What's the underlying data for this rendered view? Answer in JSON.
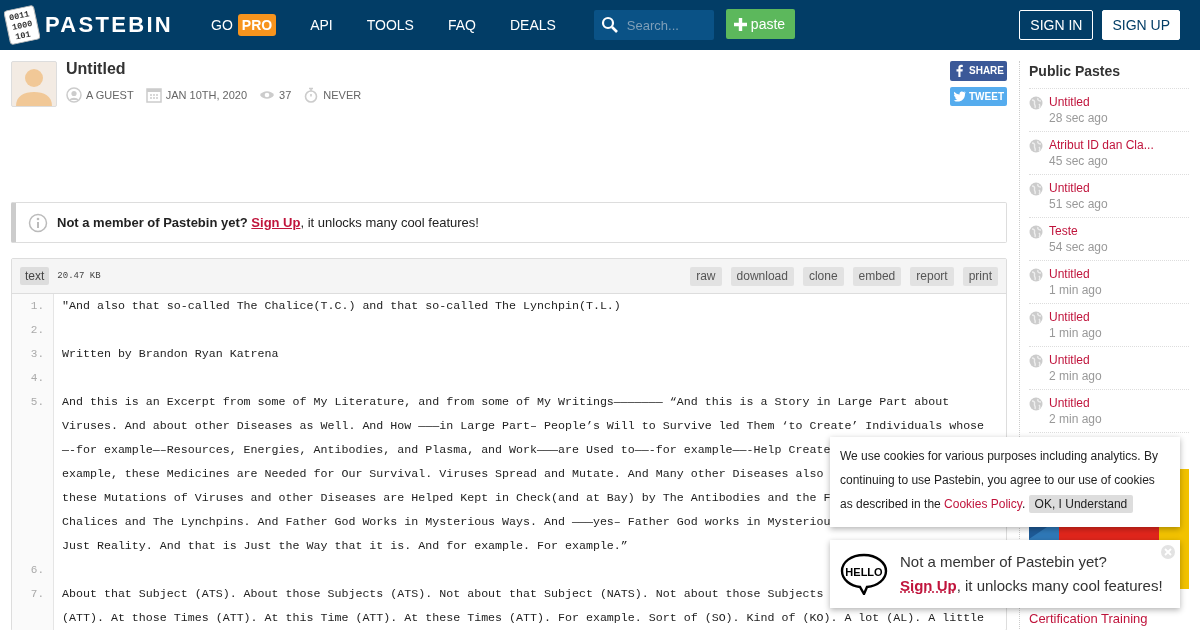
{
  "header": {
    "logo_digits": [
      "0011",
      "1000",
      "101"
    ],
    "logo_text": "PASTEBIN",
    "nav": [
      {
        "label": "GO",
        "badge": "PRO"
      },
      {
        "label": "API"
      },
      {
        "label": "TOOLS"
      },
      {
        "label": "FAQ"
      },
      {
        "label": "DEALS"
      }
    ],
    "search": {
      "placeholder": "Search..."
    },
    "new_paste": "paste",
    "sign_in": "SIGN IN",
    "sign_up": "SIGN UP"
  },
  "paste": {
    "title": "Untitled",
    "author": "A GUEST",
    "date": "JAN 10TH, 2020",
    "views": "37",
    "expires": "NEVER",
    "share": "SHARE",
    "tweet": "TWEET"
  },
  "notice": {
    "before": "**Not a member of Pastebin yet?** ",
    "link": "Sign Up",
    "after": ", it unlocks many cool features!"
  },
  "code": {
    "syntax": "text",
    "size": "20.47 KB",
    "actions": [
      "raw",
      "download",
      "clone",
      "embed",
      "report",
      "print"
    ],
    "lines": [
      {
        "number": "1.",
        "rows": [
          "\"And also that so-called The Chalice(T.C.) and that so-called The Lynchpin(T.L.)"
        ]
      },
      {
        "number": "2."
      },
      {
        "number": "3.",
        "rows": [
          "Written by Brandon Ryan Katrena"
        ]
      },
      {
        "number": "4."
      },
      {
        "number": "5.",
        "rows": [
          "And this is an Excerpt from some of My Literature, and from some of My Writings——————— “And this is a Story in Large Part about",
          "Viruses. And about other Diseases as Well. And How ———in Large Part– People’s Will to Survive led Them ‘to Create’ Individuals whose",
          "—-for example—–Resources, Energies, Antibodies, and Plasma, and Work———are Used to——-for example——-Help Create",
          "example, these Medicines are Needed for Our Survival. Viruses Spread and Mutate. And Many other Diseases also",
          "these Mutations of Viruses and other Diseases are Helped Kept in Check(and at Bay) by The Antibodies and the F",
          "Chalices and The Lynchpins. And Father God Works in Mysterious Ways. And ———yes– Father God works in Mysteriou",
          "Just Reality. And that is Just the Way that it is. And for example. For example.”"
        ]
      },
      {
        "number": "6."
      },
      {
        "number": "7.",
        "rows": [
          "About that Subject (ATS). About those Subjects (ATS). Not about that Subject (NATS). Not about those Subjects",
          "(ATT). At those Times (ATT). At this Time (ATT). At these Times (ATT). For example. Sort of (SO). Kind of (KO). A lot (AL). A little"
        ]
      }
    ]
  },
  "sidebar": {
    "title": "Public Pastes",
    "pastes": [
      {
        "title": "Untitled",
        "time": "28 sec ago"
      },
      {
        "title": "Atribut ID dan Cla...",
        "time": "45 sec ago"
      },
      {
        "title": "Untitled",
        "time": "51 sec ago"
      },
      {
        "title": "Teste",
        "time": "54 sec ago"
      },
      {
        "title": "Untitled",
        "time": "1 min ago"
      },
      {
        "title": "Untitled",
        "time": "1 min ago"
      },
      {
        "title": "Untitled",
        "time": "2 min ago"
      },
      {
        "title": "Untitled",
        "time": "2 min ago"
      }
    ],
    "ad_caption": "Certification Training"
  },
  "cookie_notice": {
    "before": "We use cookies for various purposes including analytics. By continuing to use Pastebin, you agree to our use of cookies as described in the ",
    "link": "Cookies Policy",
    "after": ".",
    "button": "OK, I Understand"
  },
  "signup_popup": {
    "badge": "HELLO",
    "line": "Not a member of Pastebin yet?",
    "link": "Sign Up",
    "after": ", it unlocks many cool features!"
  }
}
